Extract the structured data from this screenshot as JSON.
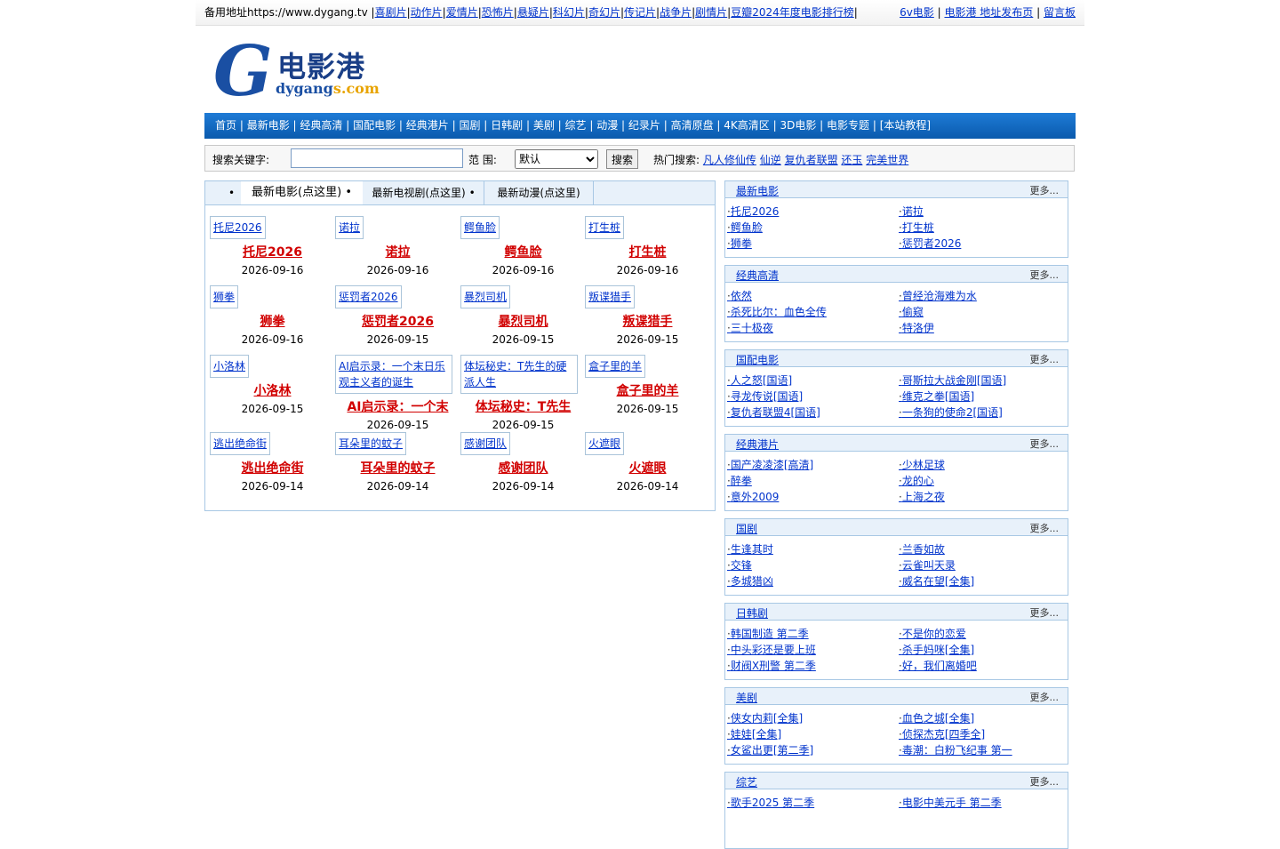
{
  "topbar": {
    "mirror_text": "备用地址https://www.dygang.tv",
    "links": [
      "喜剧片",
      "动作片",
      "爱情片",
      "恐怖片",
      "悬疑片",
      "科幻片",
      "奇幻片",
      "传记片",
      "战争片",
      "剧情片",
      "豆瓣2024年度电影排行榜"
    ],
    "right_links": [
      "6v电影",
      "电影港 地址发布页",
      "留言板"
    ]
  },
  "logo": {
    "cn": "电影港",
    "en_main": "dygang",
    "en_accent": "s.com"
  },
  "nav": [
    "首页",
    "最新电影",
    "经典高清",
    "国配电影",
    "经典港片",
    "国剧",
    "日韩剧",
    "美剧",
    "综艺",
    "动漫",
    "纪录片",
    "高清原盘",
    "4K高清区",
    "3D电影",
    "电影专题",
    "[本站教程]"
  ],
  "search": {
    "label": "搜索关键字:",
    "scope_label": "范 围:",
    "scope_value": "默认",
    "button": "搜索",
    "hot_label": "热门搜索:",
    "hot": [
      "凡人修仙传",
      "仙逆",
      "复仇者联盟",
      "还玉",
      "完美世界"
    ]
  },
  "tabs": {
    "bullet": "•",
    "movies": "最新电影(点这里)",
    "tv": "最新电视剧(点这里)",
    "anime": "最新动漫(点这里)"
  },
  "movies": [
    {
      "thumb": "托尼2026",
      "title": "托尼2026",
      "date": "2026-09-16"
    },
    {
      "thumb": "诺拉",
      "title": "诺拉",
      "date": "2026-09-16"
    },
    {
      "thumb": "鳄鱼脸",
      "title": "鳄鱼脸",
      "date": "2026-09-16"
    },
    {
      "thumb": "打生桩",
      "title": "打生桩",
      "date": "2026-09-16"
    },
    {
      "thumb": "狮拳",
      "title": "狮拳",
      "date": "2026-09-16"
    },
    {
      "thumb": "惩罚者2026",
      "title": "惩罚者2026",
      "date": "2026-09-15"
    },
    {
      "thumb": "暴烈司机",
      "title": "暴烈司机",
      "date": "2026-09-15"
    },
    {
      "thumb": "叛谍猎手",
      "title": "叛谍猎手",
      "date": "2026-09-15"
    },
    {
      "thumb": "小洛林",
      "title": "小洛林",
      "date": "2026-09-15"
    },
    {
      "thumb": "AI启示录：一个末日乐观主义者的诞生",
      "title": "AI启示录：一个末",
      "date": "2026-09-15"
    },
    {
      "thumb": "体坛秘史：T先生的硬派人生",
      "title": "体坛秘史：T先生",
      "date": "2026-09-15"
    },
    {
      "thumb": "盒子里的羊",
      "title": "盒子里的羊",
      "date": "2026-09-15"
    },
    {
      "thumb": "逃出绝命街",
      "title": "逃出绝命街",
      "date": "2026-09-14"
    },
    {
      "thumb": "耳朵里的蚊子",
      "title": "耳朵里的蚊子",
      "date": "2026-09-14"
    },
    {
      "thumb": "感谢团队",
      "title": "感谢团队",
      "date": "2026-09-14"
    },
    {
      "thumb": "火遮眼",
      "title": "火遮眼",
      "date": "2026-09-14"
    }
  ],
  "sidebar": [
    {
      "title": "最新电影",
      "more": "更多...",
      "items": [
        "托尼2026",
        "诺拉",
        "鳄鱼脸",
        "打生桩",
        "狮拳",
        "惩罚者2026"
      ]
    },
    {
      "title": "经典高清",
      "more": "更多...",
      "items": [
        "依然",
        "曾经沧海难为水",
        "杀死比尔：血色全传",
        "偷窥",
        "三十极夜",
        "特洛伊"
      ]
    },
    {
      "title": "国配电影",
      "more": "更多...",
      "items": [
        "人之怒[国语]",
        "哥斯拉大战金刚[国语]",
        "寻龙传说[国语]",
        "维克之拳[国语]",
        "复仇者联盟4[国语]",
        "一条狗的使命2[国语]"
      ]
    },
    {
      "title": "经典港片",
      "more": "更多...",
      "items": [
        "国产凌凌漆[高清]",
        "少林足球",
        "醉拳",
        "龙的心",
        "意外2009",
        "上海之夜"
      ]
    },
    {
      "title": "国剧",
      "more": "更多...",
      "items": [
        "生逢其时",
        "兰香如故",
        "交锋",
        "云雀叫天录",
        "多城猎凶",
        "威名在望[全集]"
      ]
    },
    {
      "title": "日韩剧",
      "more": "更多...",
      "items": [
        "韩国制造 第二季",
        "不是你的恋爱",
        "中头彩还是要上班",
        "杀手妈咪[全集]",
        "财阀X刑警 第二季",
        "好，我们离婚吧"
      ]
    },
    {
      "title": "美剧",
      "more": "更多...",
      "items": [
        "侠女内莉[全集]",
        "血色之城[全集]",
        "娃娃[全集]",
        "侦探杰克[四季全]",
        "女鲨出更[第二季]",
        "毒潮：白粉飞纪事 第一"
      ]
    },
    {
      "title": "综艺",
      "more": "更多...",
      "items": [
        "歌手2025 第二季",
        "电影中美元手 第二季"
      ]
    }
  ]
}
